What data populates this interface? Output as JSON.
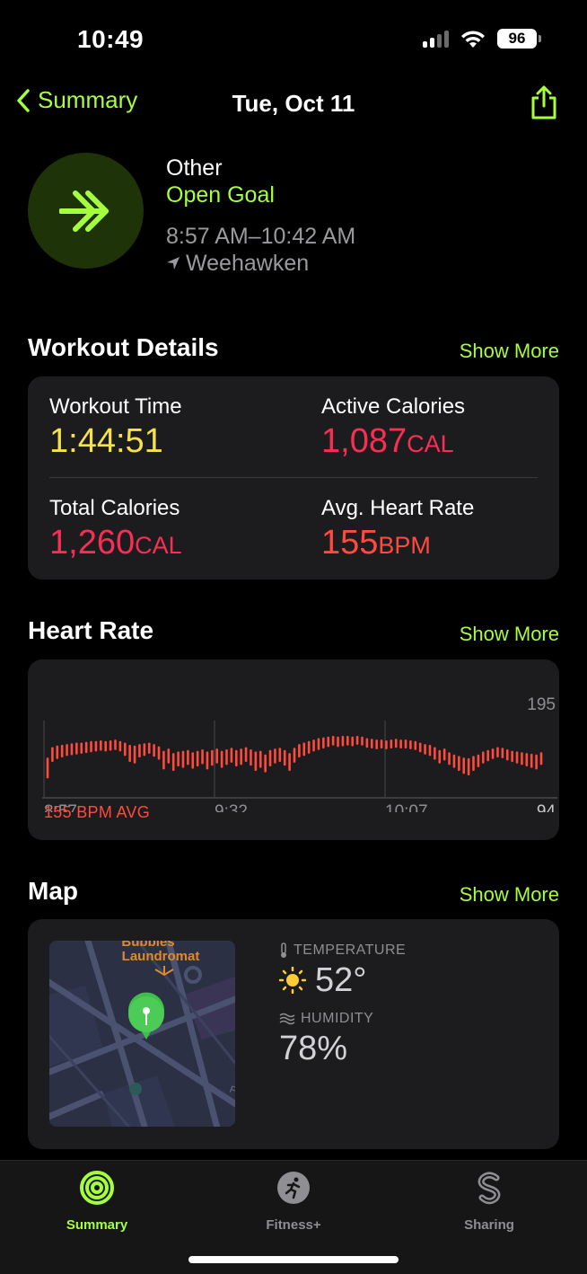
{
  "status": {
    "time": "10:49",
    "battery": "96"
  },
  "nav": {
    "back_label": "Summary",
    "title": "Tue, Oct 11"
  },
  "workout": {
    "type": "Other",
    "goal": "Open Goal",
    "time_range": "8:57 AM–10:42 AM",
    "location": "Weehawken"
  },
  "details": {
    "title": "Workout Details",
    "show_more": "Show More",
    "workout_time_label": "Workout Time",
    "workout_time": "1:44:51",
    "active_cal_label": "Active Calories",
    "active_cal": "1,087",
    "active_cal_unit": "CAL",
    "total_cal_label": "Total Calories",
    "total_cal": "1,260",
    "total_cal_unit": "CAL",
    "avg_hr_label": "Avg. Heart Rate",
    "avg_hr": "155",
    "avg_hr_unit": "BPM"
  },
  "heart_rate": {
    "title": "Heart Rate",
    "show_more": "Show More",
    "avg_label": "155 BPM AVG"
  },
  "chart_data": {
    "type": "bar",
    "x_ticks": [
      "8:57",
      "9:32",
      "10:07"
    ],
    "ylim": [
      94,
      195
    ],
    "y_ticks": [
      94,
      195
    ],
    "color": "#ff4a3d",
    "series": [
      {
        "values": [
          [
            120,
            148
          ],
          [
            142,
            162
          ],
          [
            146,
            164
          ],
          [
            148,
            165
          ],
          [
            150,
            166
          ],
          [
            151,
            167
          ],
          [
            152,
            168
          ],
          [
            153,
            168
          ],
          [
            154,
            169
          ],
          [
            155,
            170
          ],
          [
            156,
            170
          ],
          [
            157,
            171
          ],
          [
            156,
            170
          ],
          [
            157,
            171
          ],
          [
            158,
            172
          ],
          [
            156,
            170
          ],
          [
            150,
            168
          ],
          [
            142,
            165
          ],
          [
            140,
            164
          ],
          [
            148,
            166
          ],
          [
            150,
            167
          ],
          [
            153,
            168
          ],
          [
            149,
            166
          ],
          [
            145,
            163
          ],
          [
            132,
            157
          ],
          [
            140,
            160
          ],
          [
            130,
            154
          ],
          [
            136,
            156
          ],
          [
            134,
            157
          ],
          [
            138,
            158
          ],
          [
            133,
            155
          ],
          [
            136,
            157
          ],
          [
            139,
            159
          ],
          [
            132,
            156
          ],
          [
            137,
            158
          ],
          [
            140,
            160
          ],
          [
            134,
            157
          ],
          [
            138,
            159
          ],
          [
            141,
            161
          ],
          [
            136,
            158
          ],
          [
            138,
            160
          ],
          [
            142,
            162
          ],
          [
            137,
            159
          ],
          [
            130,
            156
          ],
          [
            134,
            157
          ],
          [
            128,
            152
          ],
          [
            136,
            158
          ],
          [
            140,
            160
          ],
          [
            142,
            161
          ],
          [
            137,
            158
          ],
          [
            130,
            154
          ],
          [
            141,
            161
          ],
          [
            148,
            166
          ],
          [
            150,
            168
          ],
          [
            153,
            170
          ],
          [
            156,
            172
          ],
          [
            158,
            174
          ],
          [
            160,
            175
          ],
          [
            162,
            176
          ],
          [
            164,
            177
          ],
          [
            162,
            176
          ],
          [
            163,
            177
          ],
          [
            164,
            177
          ],
          [
            163,
            176
          ],
          [
            165,
            177
          ],
          [
            164,
            176
          ],
          [
            161,
            174
          ],
          [
            160,
            173
          ],
          [
            159,
            172
          ],
          [
            160,
            172
          ],
          [
            159,
            171
          ],
          [
            160,
            172
          ],
          [
            161,
            173
          ],
          [
            160,
            172
          ],
          [
            160,
            172
          ],
          [
            159,
            171
          ],
          [
            158,
            170
          ],
          [
            155,
            168
          ],
          [
            152,
            166
          ],
          [
            150,
            165
          ],
          [
            145,
            162
          ],
          [
            140,
            158
          ],
          [
            144,
            160
          ],
          [
            138,
            155
          ],
          [
            134,
            152
          ],
          [
            130,
            150
          ],
          [
            126,
            148
          ],
          [
            124,
            147
          ],
          [
            130,
            150
          ],
          [
            135,
            152
          ],
          [
            140,
            156
          ],
          [
            143,
            158
          ],
          [
            146,
            160
          ],
          [
            148,
            162
          ],
          [
            147,
            161
          ],
          [
            144,
            159
          ],
          [
            142,
            157
          ],
          [
            140,
            156
          ],
          [
            138,
            155
          ],
          [
            136,
            154
          ],
          [
            134,
            153
          ],
          [
            132,
            152
          ],
          [
            138,
            155
          ]
        ]
      }
    ]
  },
  "map": {
    "title": "Map",
    "show_more": "Show More",
    "poi_name_line1": "Bubbles",
    "poi_name_line2": "Laundromat",
    "street_label": "FU",
    "temperature_label": "TEMPERATURE",
    "temperature": "52°",
    "humidity_label": "HUMIDITY",
    "humidity": "78%"
  },
  "tabs": [
    {
      "label": "Summary",
      "active": true
    },
    {
      "label": "Fitness+",
      "active": false
    },
    {
      "label": "Sharing",
      "active": false
    }
  ],
  "colors": {
    "accent": "#a6ff3c",
    "chart": "#ff4a3d",
    "card": "#1c1c1e"
  }
}
